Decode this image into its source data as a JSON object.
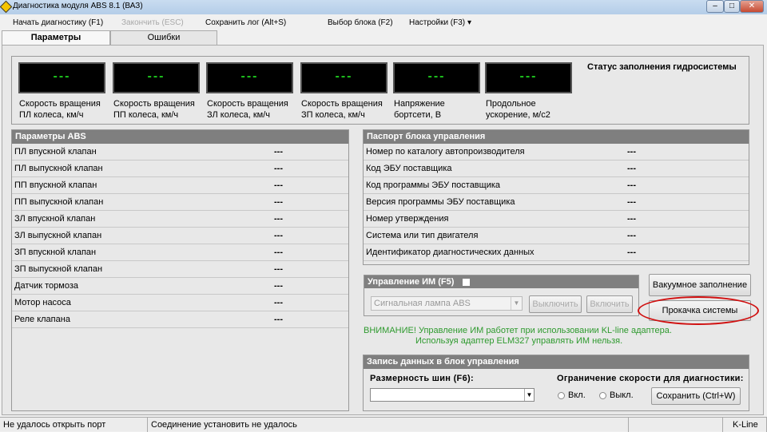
{
  "window": {
    "title": "Диагностика модуля ABS 8.1 (ВАЗ)",
    "minimize": "–",
    "maximize": "□",
    "close": "✕"
  },
  "menu": {
    "start": "Начать диагностику (F1)",
    "stop": "Закончить (ESC)",
    "save_log": "Сохранить лог (Alt+S)",
    "select_block": "Выбор блока (F2)",
    "settings": "Настройки (F3)",
    "settings_arrow": "▾"
  },
  "tabs": [
    "Параметры",
    "Ошибки"
  ],
  "gauges": [
    {
      "value": "---",
      "label1": "Скорость вращения",
      "label2": "ПЛ колеса, км/ч"
    },
    {
      "value": "---",
      "label1": "Скорость вращения",
      "label2": "ПП колеса, км/ч"
    },
    {
      "value": "---",
      "label1": "Скорость вращения",
      "label2": "ЗЛ колеса, км/ч"
    },
    {
      "value": "---",
      "label1": "Скорость вращения",
      "label2": "ЗП колеса, км/ч"
    },
    {
      "value": "---",
      "label1": "Напряжение",
      "label2": "бортсети, В"
    },
    {
      "value": "---",
      "label1": "Продольное",
      "label2": "ускорение, м/с2"
    }
  ],
  "hydro_status": "Статус заполнения гидросистемы",
  "abs_params": {
    "title": "Параметры ABS",
    "rows": [
      {
        "name": "ПЛ впускной клапан",
        "value": "---"
      },
      {
        "name": "ПЛ выпускной клапан",
        "value": "---"
      },
      {
        "name": "ПП впускной клапан",
        "value": "---"
      },
      {
        "name": "ПП выпускной клапан",
        "value": "---"
      },
      {
        "name": "ЗЛ впускной клапан",
        "value": "---"
      },
      {
        "name": "ЗЛ выпускной клапан",
        "value": "---"
      },
      {
        "name": "ЗП впускной клапан",
        "value": "---"
      },
      {
        "name": "ЗП выпускной клапан",
        "value": "---"
      },
      {
        "name": "Датчик тормоза",
        "value": "---"
      },
      {
        "name": "Мотор насоса",
        "value": "---"
      },
      {
        "name": "Реле клапана",
        "value": "---"
      }
    ]
  },
  "passport": {
    "title": "Паспорт блока управления",
    "rows": [
      {
        "name": "Номер по каталогу автопроизводителя",
        "value": "---"
      },
      {
        "name": "Код ЭБУ поставщика",
        "value": "---"
      },
      {
        "name": "Код программы ЭБУ поставщика",
        "value": "---"
      },
      {
        "name": "Версия программы ЭБУ поставщика",
        "value": "---"
      },
      {
        "name": "Номер утверждения",
        "value": "---"
      },
      {
        "name": "Система или тип двигателя",
        "value": "---"
      },
      {
        "name": "Идентификатор диагностических данных",
        "value": "---"
      }
    ]
  },
  "im_control": {
    "title": "Управление ИМ (F5)",
    "select_value": "Сигнальная лампа ABS",
    "off": "Выключить",
    "on": "Включить"
  },
  "buttons": {
    "vacuum": "Вакуумное заполнение",
    "bleed": "Прокачка системы"
  },
  "warning": {
    "line1": "ВНИМАНИЕ! Управление ИМ работет при использовании KL-line адаптера.",
    "line2": "Используя адаптер ELM327 управлять ИМ нельзя."
  },
  "write": {
    "title": "Запись данных в блок управления",
    "tire_label": "Размерность шин (F6):",
    "tire_value": "",
    "speed_label": "Ограничение скорости для диагностики:",
    "on": "Вкл.",
    "off": "Выкл.",
    "save": "Сохранить  (Ctrl+W)"
  },
  "status": {
    "port": "Не удалось открыть порт",
    "connection": "Соединение установить не удалось",
    "empty": "",
    "protocol": "K-Line"
  },
  "colors": {
    "display_text": "#1ec81e",
    "warning": "#2e9a2e",
    "highlight": "#d01010"
  }
}
